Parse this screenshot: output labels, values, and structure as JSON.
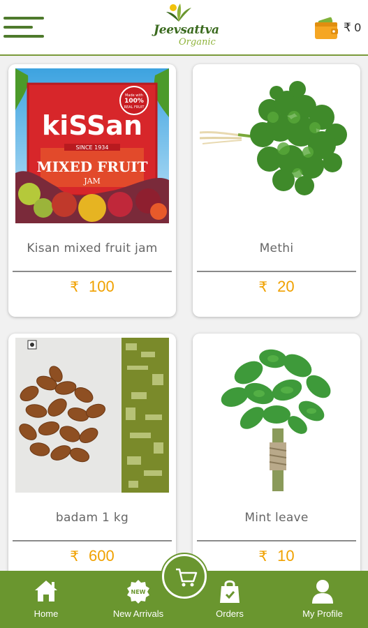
{
  "header": {
    "brand": "Jeevsattva",
    "brand_sub": "Organic",
    "wallet_balance": "₹ 0",
    "menu_icon": "hamburger-icon",
    "wallet_icon": "wallet-icon"
  },
  "products": [
    {
      "name": "Kisan mixed fruit jam",
      "currency": "₹",
      "price": "100",
      "image": "kissan-jam-image"
    },
    {
      "name": "Methi",
      "currency": "₹",
      "price": "20",
      "image": "methi-image"
    },
    {
      "name": "badam 1 kg",
      "currency": "₹",
      "price": "600",
      "image": "almonds-image"
    },
    {
      "name": "Mint leave",
      "currency": "₹",
      "price": "10",
      "image": "mint-image"
    }
  ],
  "kissan_label": {
    "brand": "kiSSan",
    "since": "SINCE 1934",
    "line1": "MIXED FRUIT",
    "line2": "JAM",
    "badge_top": "Made with",
    "badge_mid": "100%",
    "badge_bottom": "REAL FRUIT"
  },
  "bottom_nav": {
    "home": "Home",
    "new_arrivals": "New Arrivals",
    "new_badge": "NEW",
    "orders": "Orders",
    "profile": "My Profile"
  },
  "colors": {
    "accent_green": "#6a962f",
    "price_orange": "#f0a100",
    "header_line": "#7a9a3a"
  }
}
